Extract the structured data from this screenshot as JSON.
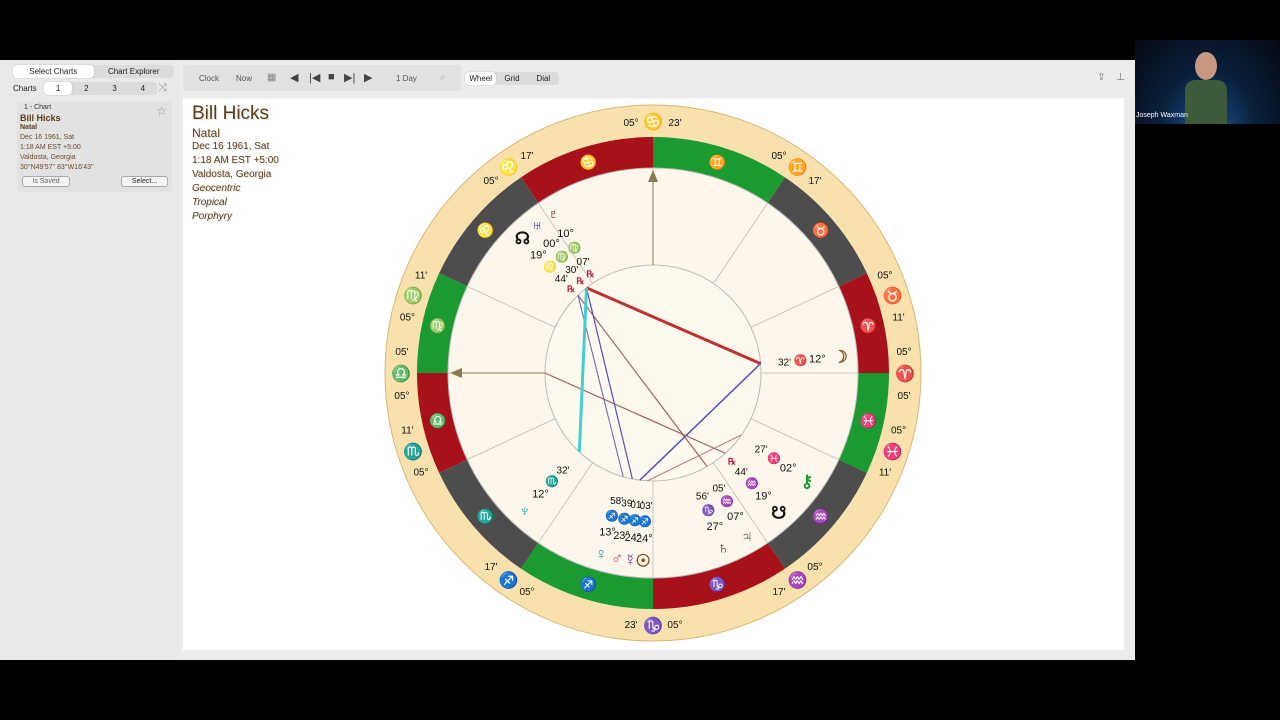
{
  "sidebar": {
    "tabs": [
      "Select Charts",
      "Chart Explorer"
    ],
    "charts_label": "Charts",
    "chart_numbers": [
      "1",
      "2",
      "3",
      "4"
    ],
    "shuffle_icon": "shuffle-icon",
    "card": {
      "title": "1 - Chart",
      "name": "Bill Hicks",
      "type": "Natal",
      "date": "Dec 16 1961, Sat",
      "time": "1:18 AM EST +5:00",
      "place": "Valdosta, Georgia",
      "coords": "30°N49'57\" 83°W16'43\"",
      "saved_label": "Is Saved",
      "select_label": "Select..."
    }
  },
  "toolbar": {
    "clock": "Clock",
    "now": "Now",
    "interval": "1 Day",
    "views": [
      "Wheel",
      "Grid",
      "Dial"
    ],
    "active_view": "Wheel"
  },
  "chart_info": {
    "name": "Bill Hicks",
    "type": "Natal",
    "date": "Dec 16 1961, Sat",
    "time": "1:18 AM EST +5:00",
    "place": "Valdosta, Georgia",
    "zodiac1": "Geocentric",
    "zodiac2": "Tropical",
    "houses": "Porphyry"
  },
  "wheel": {
    "cusps": [
      {
        "deg": "05°",
        "sign": "♋",
        "min": "23'",
        "color": "#2b3fbf"
      },
      {
        "deg": "05°",
        "sign": "♊",
        "min": "17'",
        "color": "#3cc4c0"
      },
      {
        "deg": "05°",
        "sign": "♉",
        "min": "11'",
        "color": "#8a8440"
      },
      {
        "deg": "05°",
        "sign": "♈",
        "min": "05'",
        "color": "#d01a1a"
      },
      {
        "deg": "05°",
        "sign": "♓",
        "min": "11'",
        "color": "#1a2ed0"
      },
      {
        "deg": "05°",
        "sign": "♒",
        "min": "17'",
        "color": "#2ac4c4"
      },
      {
        "deg": "05°",
        "sign": "♑",
        "min": "23'",
        "color": "#8a8440"
      },
      {
        "deg": "05°",
        "sign": "♐",
        "min": "17'",
        "color": "#d01a1a"
      },
      {
        "deg": "05°",
        "sign": "♏",
        "min": "11'",
        "color": "#1a2ed0"
      },
      {
        "deg": "05°",
        "sign": "♎",
        "min": "05'",
        "color": "#2ac4c4"
      },
      {
        "deg": "05°",
        "sign": "♍",
        "min": "11'",
        "color": "#8a8440"
      },
      {
        "deg": "05°",
        "sign": "♌",
        "min": "17'",
        "color": "#d01a1a"
      }
    ],
    "planets": [
      {
        "name": "North Node",
        "glyph": "☊",
        "deg": "19°",
        "sign": "♌",
        "min": "44'",
        "retro": "℞"
      },
      {
        "name": "Uranus",
        "glyph": "♅",
        "deg": "00°",
        "sign": "♍",
        "min": "30'",
        "retro": "℞"
      },
      {
        "name": "Pluto",
        "glyph": "♇",
        "deg": "10°",
        "sign": "♍",
        "min": "07'",
        "retro": "℞"
      },
      {
        "name": "Moon",
        "glyph": "☽",
        "deg": "12°",
        "sign": "♈",
        "min": "32'"
      },
      {
        "name": "Neptune",
        "glyph": "♆",
        "deg": "12°",
        "sign": "♏",
        "min": "32'"
      },
      {
        "name": "Venus",
        "glyph": "♀",
        "deg": "13°",
        "sign": "♐",
        "min": "58'"
      },
      {
        "name": "Mars",
        "glyph": "♂",
        "deg": "23°",
        "sign": "♐",
        "min": "39'"
      },
      {
        "name": "Mercury",
        "glyph": "☿",
        "deg": "24°",
        "sign": "♐",
        "min": "01'"
      },
      {
        "name": "Sun",
        "glyph": "☉",
        "deg": "24°",
        "sign": "♐",
        "min": "03'"
      },
      {
        "name": "Saturn",
        "glyph": "♄",
        "deg": "27°",
        "sign": "♑",
        "min": "56'"
      },
      {
        "name": "Jupiter",
        "glyph": "♃",
        "deg": "07°",
        "sign": "♒",
        "min": "05'"
      },
      {
        "name": "South Node",
        "glyph": "☋",
        "deg": "19°",
        "sign": "♒",
        "min": "44'",
        "retro": "℞"
      },
      {
        "name": "Chiron",
        "glyph": "⚷",
        "deg": "02°",
        "sign": "♓",
        "min": "27'"
      }
    ]
  },
  "video": {
    "participant": "Joseph Waxman"
  }
}
